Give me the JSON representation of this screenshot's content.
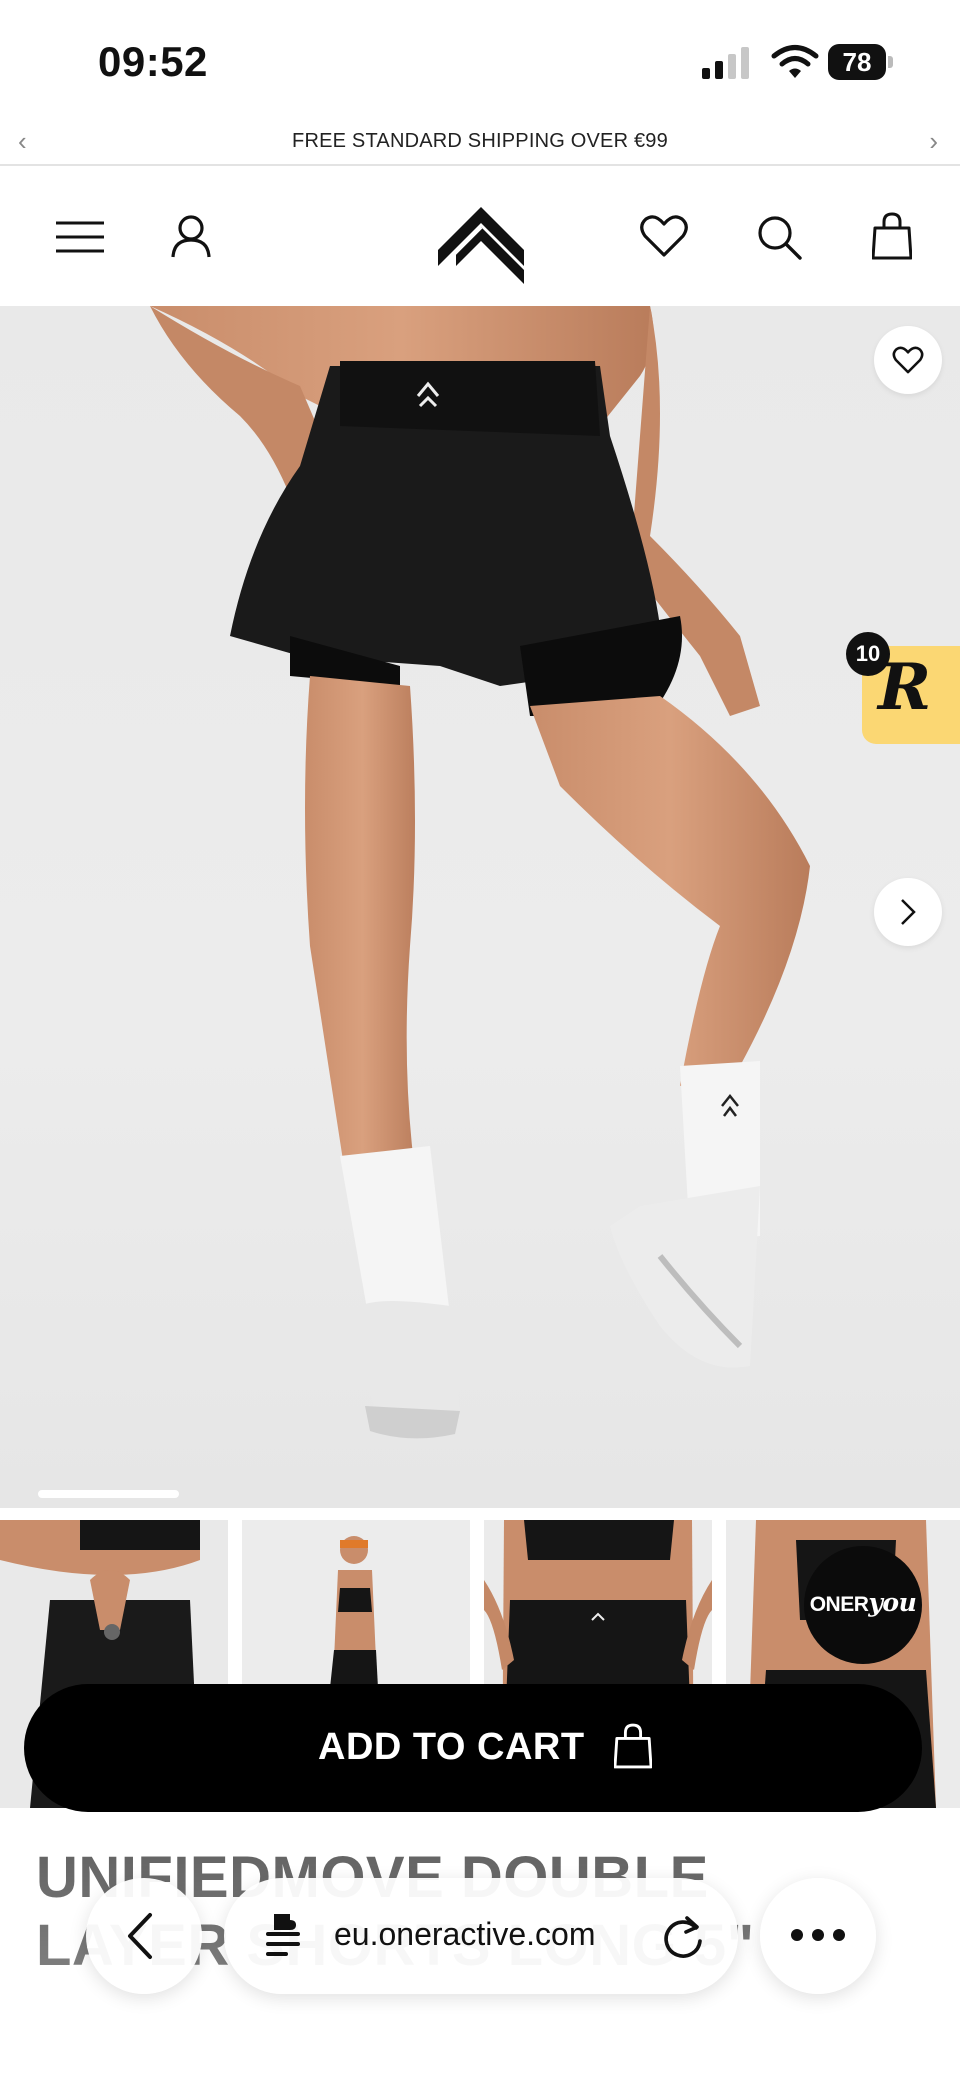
{
  "status_bar": {
    "time": "09:52",
    "battery": "78"
  },
  "promo": {
    "text": "FREE STANDARD SHIPPING OVER €99",
    "prev_icon": "chevron-left-icon",
    "next_icon": "chevron-right-icon"
  },
  "header": {
    "icons": [
      "menu-icon",
      "account-icon",
      "brand-logo",
      "heart-icon",
      "search-icon",
      "bag-icon"
    ]
  },
  "gallery": {
    "current_slide": 1,
    "thumbnail_count": 4,
    "progress_fraction": 0.16
  },
  "rewards": {
    "letter": "R",
    "badge_count": "10"
  },
  "oneryou": {
    "prefix": "ONER",
    "suffix": "you"
  },
  "cart": {
    "button_label": "ADD TO CART"
  },
  "product": {
    "title": "UNIFIEDMOVE DOUBLE LAYER SHORTS LONG 5\""
  },
  "browser": {
    "url": "eu.oneractive.com"
  },
  "colors": {
    "accent": "#000000",
    "rewards_bg": "#fbd773",
    "hero_bg": "#ebebeb"
  }
}
